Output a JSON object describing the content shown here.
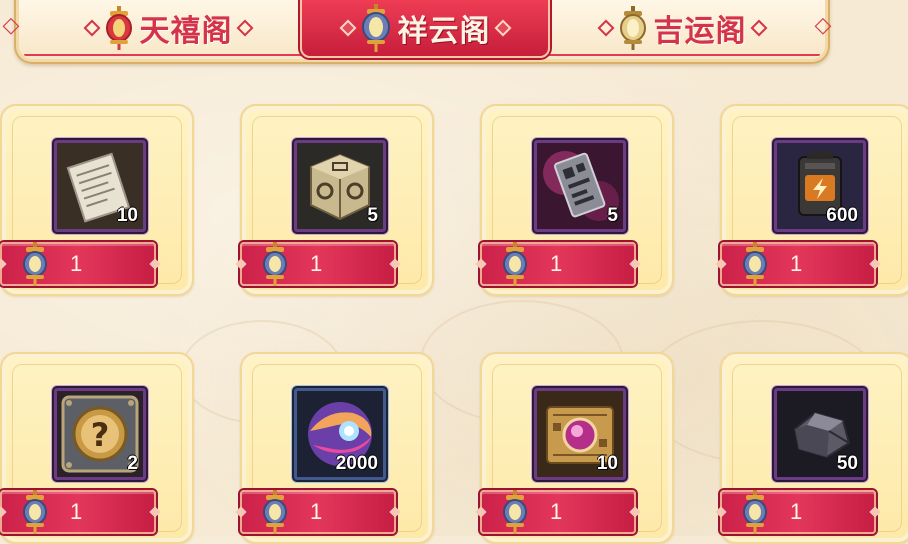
{
  "tabs": [
    {
      "label": "天禧阁",
      "active": false,
      "icon": "red-lantern-icon"
    },
    {
      "label": "祥云阁",
      "active": true,
      "icon": "blue-lantern-icon"
    },
    {
      "label": "吉运阁",
      "active": false,
      "icon": "gold-lantern-icon"
    }
  ],
  "currency_icon": "lantern-token-icon",
  "items": [
    {
      "name": "document-scroll",
      "icon": "paper-scroll-icon",
      "quantity": "10",
      "price": "1"
    },
    {
      "name": "ornate-box",
      "icon": "carved-cube-icon",
      "quantity": "5",
      "price": "1"
    },
    {
      "name": "pink-card",
      "icon": "qr-card-icon",
      "quantity": "5",
      "price": "1"
    },
    {
      "name": "battery-pack",
      "icon": "battery-icon",
      "quantity": "600",
      "price": "1"
    },
    {
      "name": "mystery-box",
      "icon": "question-mark-icon",
      "quantity": "2",
      "price": "1"
    },
    {
      "name": "energy-orb",
      "icon": "swirl-orb-icon",
      "quantity": "2000",
      "price": "1"
    },
    {
      "name": "pink-gem-tablet",
      "icon": "gem-tablet-icon",
      "quantity": "10",
      "price": "1"
    },
    {
      "name": "ore-stone",
      "icon": "ore-rock-icon",
      "quantity": "50",
      "price": "1"
    }
  ],
  "colors": {
    "accent_red": "#d3344a",
    "card_bg": "#fdecae",
    "background": "#f6ead4"
  }
}
